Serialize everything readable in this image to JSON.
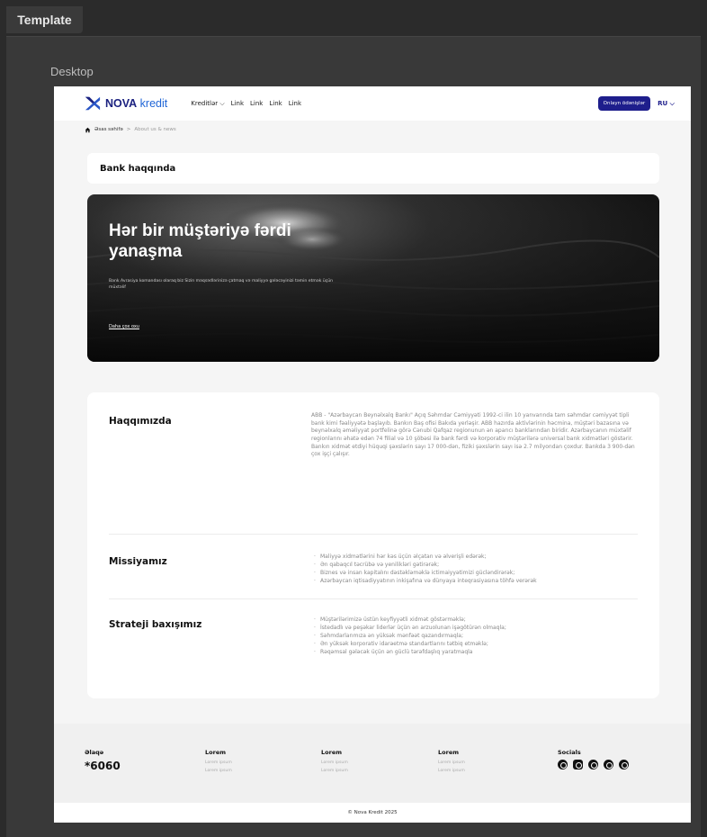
{
  "chrome": {
    "template_tab": "Template",
    "frame_label": "Desktop"
  },
  "nav": {
    "logo_bold": "NOVA",
    "logo_light": "kredit",
    "links": [
      "Kreditlər ⌵",
      "Link",
      "Link",
      "Link",
      "Link"
    ],
    "online_button": "Onlayn ödənişlər",
    "lang": "RU ⌵"
  },
  "breadcrumb": {
    "home": "Əsas səhifə",
    "sep": ">",
    "current": "About us & news"
  },
  "section_pill": "Bank haqqında",
  "hero": {
    "title": "Hər bir müştəriyə fərdi yanaşma",
    "desc": "Bank Avrasiya komandası olaraq biz Sizin məqsədlərinizə çatmaq və maliyyə gələcəyinizi təmin etmək üçün müxtəlif",
    "link": "Daha çox oxu"
  },
  "about": {
    "rows": [
      {
        "title": "Haqqımızda",
        "text": "ABB - \"Azərbaycan Beynəlxalq Bankı\" Açıq Səhmdar Cəmiyyəti 1992-ci ilin 10 yanvarında tam səhmdar cəmiyyət tipli bank kimi fəaliyyətə başlayıb. Bankın Baş ofisi Bakıda yerləşir. ABB hazırda aktivlərinin həcmina, müştəri bazasına və beynəlxalq əməliyyat portfelinə görə Cənubi Qafqaz regionunun ən aparıcı banklarından biridir. Azərbaycanın müxtəlif regionlarını əhatə edən 74 filial və 10 şöbəsi ilə bank fərdi və korporativ müştərilərə universal bank xidmətləri göstərir. Bankın xidmət etdiyi hüquqi şəxslərin sayı 17 000-dən, fiziki şəxslərin sayı isə 2.7 milyondan çoxdur. Bankda 3 900-dən çox işçi çalışır."
      },
      {
        "title": "Missiyamız",
        "items": [
          "Maliyyə xidmətlərini hər kəs üçün əlçatan və əlverişli edərək;",
          "Ən qabaqcıl təcrübə və yenilikləri gətirərək;",
          "Biznes və insan kapitalını dəstəkləməklə ictimaiyyətimizi gücləndirərək;",
          "Azərbaycan iqtisadiyyatının inkişafına və dünyaya inteqrasiyasına töhfə verərək"
        ]
      },
      {
        "title": "Strateji baxışımız",
        "items": [
          "Müştərilərimizə üstün keyfiyyətli xidmət göstərməklə;",
          "İstedadlı və peşəkar liderlər üçün ən arzuolunan işəgötürən olmaqla;",
          "Səhmdarlarımıza ən yüksək mənfəət qazandırmaqla;",
          "Ən yüksək korporativ idarəetmə standartlarını tətbiq etməklə;",
          "Rəqəmsal gələcək üçün ən güclü tərəfdaşlıq yaratmaqla"
        ]
      }
    ]
  },
  "footer": {
    "contact_title": "Əlaqə",
    "phone": "*6060",
    "cols": [
      {
        "title": "Lorem",
        "items": [
          "Lorem ipsum",
          "Lorem ipsum"
        ]
      },
      {
        "title": "Lorem",
        "items": [
          "Lorem ipsum",
          "Lorem ipsum"
        ]
      },
      {
        "title": "Lorem",
        "items": [
          "Lorem ipsum",
          "Lorem ipsum"
        ]
      }
    ],
    "socials_title": "Socials",
    "socials": [
      "facebook-icon",
      "instagram-icon",
      "messenger-icon",
      "whatsapp-icon",
      "telegram-icon"
    ],
    "copyright": "© Nova Kredit 2025"
  }
}
